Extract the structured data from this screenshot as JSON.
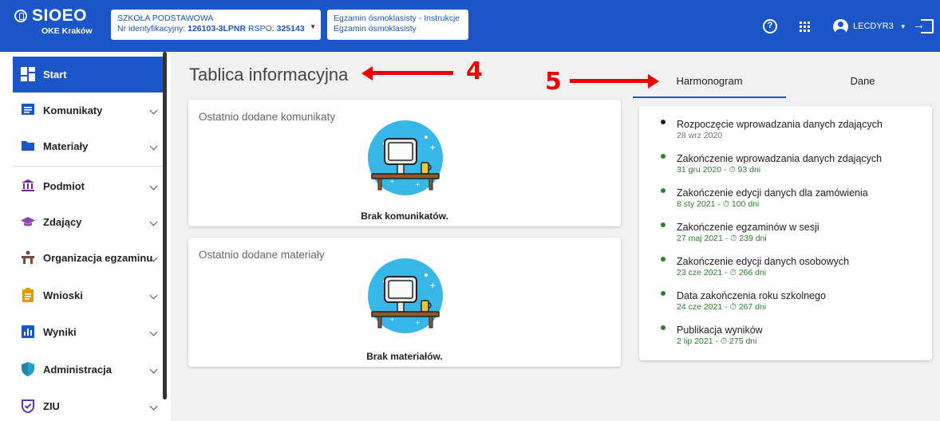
{
  "header": {
    "app_name": "SIOEO",
    "org": "OKE Kraków",
    "school": {
      "type": "SZKOŁA PODSTAWOWA",
      "id_label": "Nr identyfikacyjny:",
      "id_value": "126103-3LPNR",
      "rspo_label": "RSPO:",
      "rspo_value": "325143"
    },
    "exam": {
      "line1": "Egzamin ósmoklasisty - Instrukcje",
      "line2": "Egzamin ósmoklasisty"
    },
    "user": "LECDYR3",
    "icons": [
      "help-icon",
      "apps-icon",
      "account-icon",
      "logout-icon"
    ]
  },
  "sidebar": {
    "items": [
      {
        "label": "Start",
        "icon": "dashboard-icon",
        "active": true
      },
      {
        "label": "Komunikaty",
        "icon": "message-icon"
      },
      {
        "label": "Materiały",
        "icon": "folder-icon"
      },
      {
        "label": "Podmiot",
        "icon": "institution-icon"
      },
      {
        "label": "Zdający",
        "icon": "graduation-cap-icon"
      },
      {
        "label": "Organizacja egzaminu",
        "icon": "desk-icon"
      },
      {
        "label": "Wnioski",
        "icon": "clipboard-icon"
      },
      {
        "label": "Wyniki",
        "icon": "bar-chart-icon"
      },
      {
        "label": "Administracja",
        "icon": "shield-icon"
      },
      {
        "label": "ZIU",
        "icon": "badge-check-icon"
      }
    ]
  },
  "main": {
    "title": "Tablica informacyjna",
    "annotations": [
      "4",
      "5"
    ],
    "cards": [
      {
        "title": "Ostatnio dodane komunikaty",
        "empty": "Brak komunikatów."
      },
      {
        "title": "Ostatnio dodane materiały",
        "empty": "Brak materiałów."
      }
    ]
  },
  "tabs": [
    {
      "label": "Harmonogram",
      "active": true
    },
    {
      "label": "Dane",
      "active": false
    }
  ],
  "schedule": [
    {
      "title": "Rozpoczęcie wprowadzania danych zdających",
      "date": "28 wrz 2020",
      "days": "",
      "status": "past"
    },
    {
      "title": "Zakończenie wprowadzania danych zdających",
      "date": "31 gru 2020",
      "days": "93 dni",
      "status": "future"
    },
    {
      "title": "Zakończenie edycji danych dla zamówienia",
      "date": "8 sty 2021",
      "days": "100 dni",
      "status": "future"
    },
    {
      "title": "Zakończenie egzaminów w sesji",
      "date": "27 maj 2021",
      "days": "239 dni",
      "status": "future"
    },
    {
      "title": "Zakończenie edycji danych osobowych",
      "date": "23 cze 2021",
      "days": "266 dni",
      "status": "future"
    },
    {
      "title": "Data zakończenia roku szkolnego",
      "date": "24 cze 2021",
      "days": "267 dni",
      "status": "future"
    },
    {
      "title": "Publikacja wyników",
      "date": "2 lip 2021",
      "days": "275 dni",
      "status": "future"
    }
  ],
  "colors": {
    "primary": "#1a56c8",
    "future": "#2e7d32",
    "past": "#757575",
    "annotation": "#e00000"
  }
}
